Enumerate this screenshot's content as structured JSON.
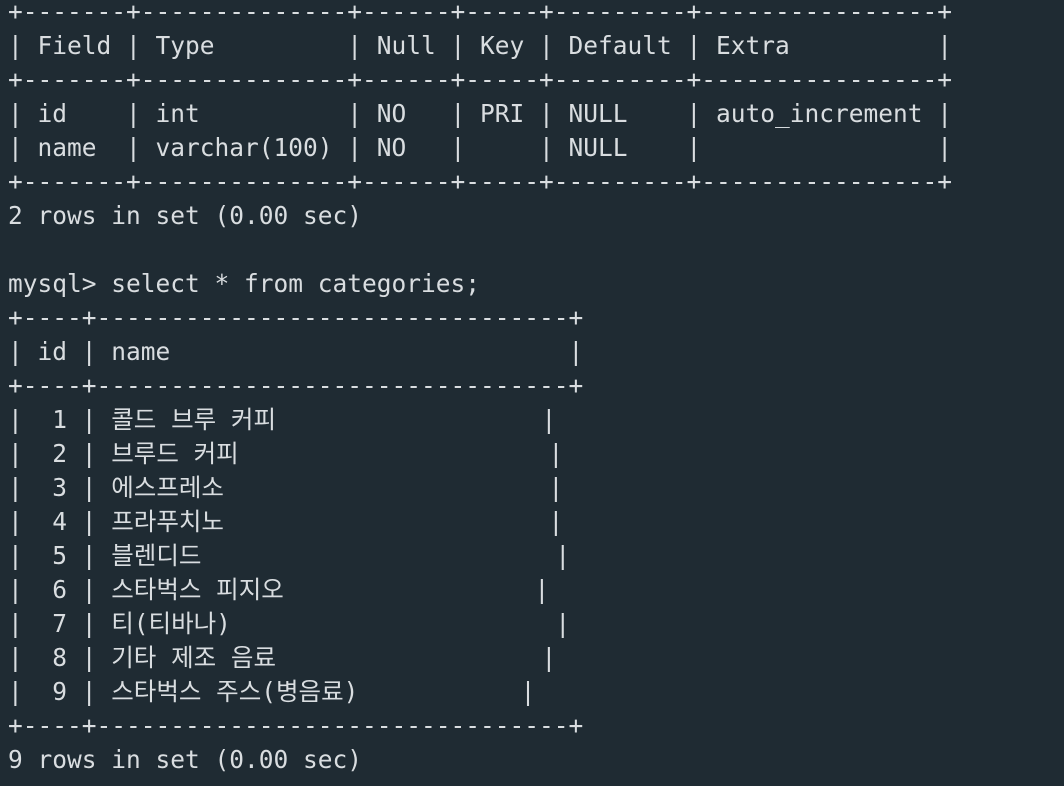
{
  "terminal": {
    "lines": [
      "+-------+--------------+------+-----+---------+----------------+",
      "| Field | Type         | Null | Key | Default | Extra          |",
      "+-------+--------------+------+-----+---------+----------------+",
      "| id    | int          | NO   | PRI | NULL    | auto_increment |",
      "| name  | varchar(100) | NO   |     | NULL    |                |",
      "+-------+--------------+------+-----+---------+----------------+",
      "2 rows in set (0.00 sec)",
      "",
      "mysql> select * from categories;",
      "+----+--------------------------------+",
      "| id | name                           |",
      "+----+--------------------------------+",
      "|  1 | 콜드 브루 커피                  |",
      "|  2 | 브루드 커피                     |",
      "|  3 | 에스프레소                      |",
      "|  4 | 프라푸치노                      |",
      "|  5 | 블렌디드                        |",
      "|  6 | 스타벅스 피지오                 |",
      "|  7 | 티(티바나)                      |",
      "|  8 | 기타 제조 음료                  |",
      "|  9 | 스타벅스 주스(병음료)           |",
      "+----+--------------------------------+",
      "9 rows in set (0.00 sec)"
    ]
  }
}
